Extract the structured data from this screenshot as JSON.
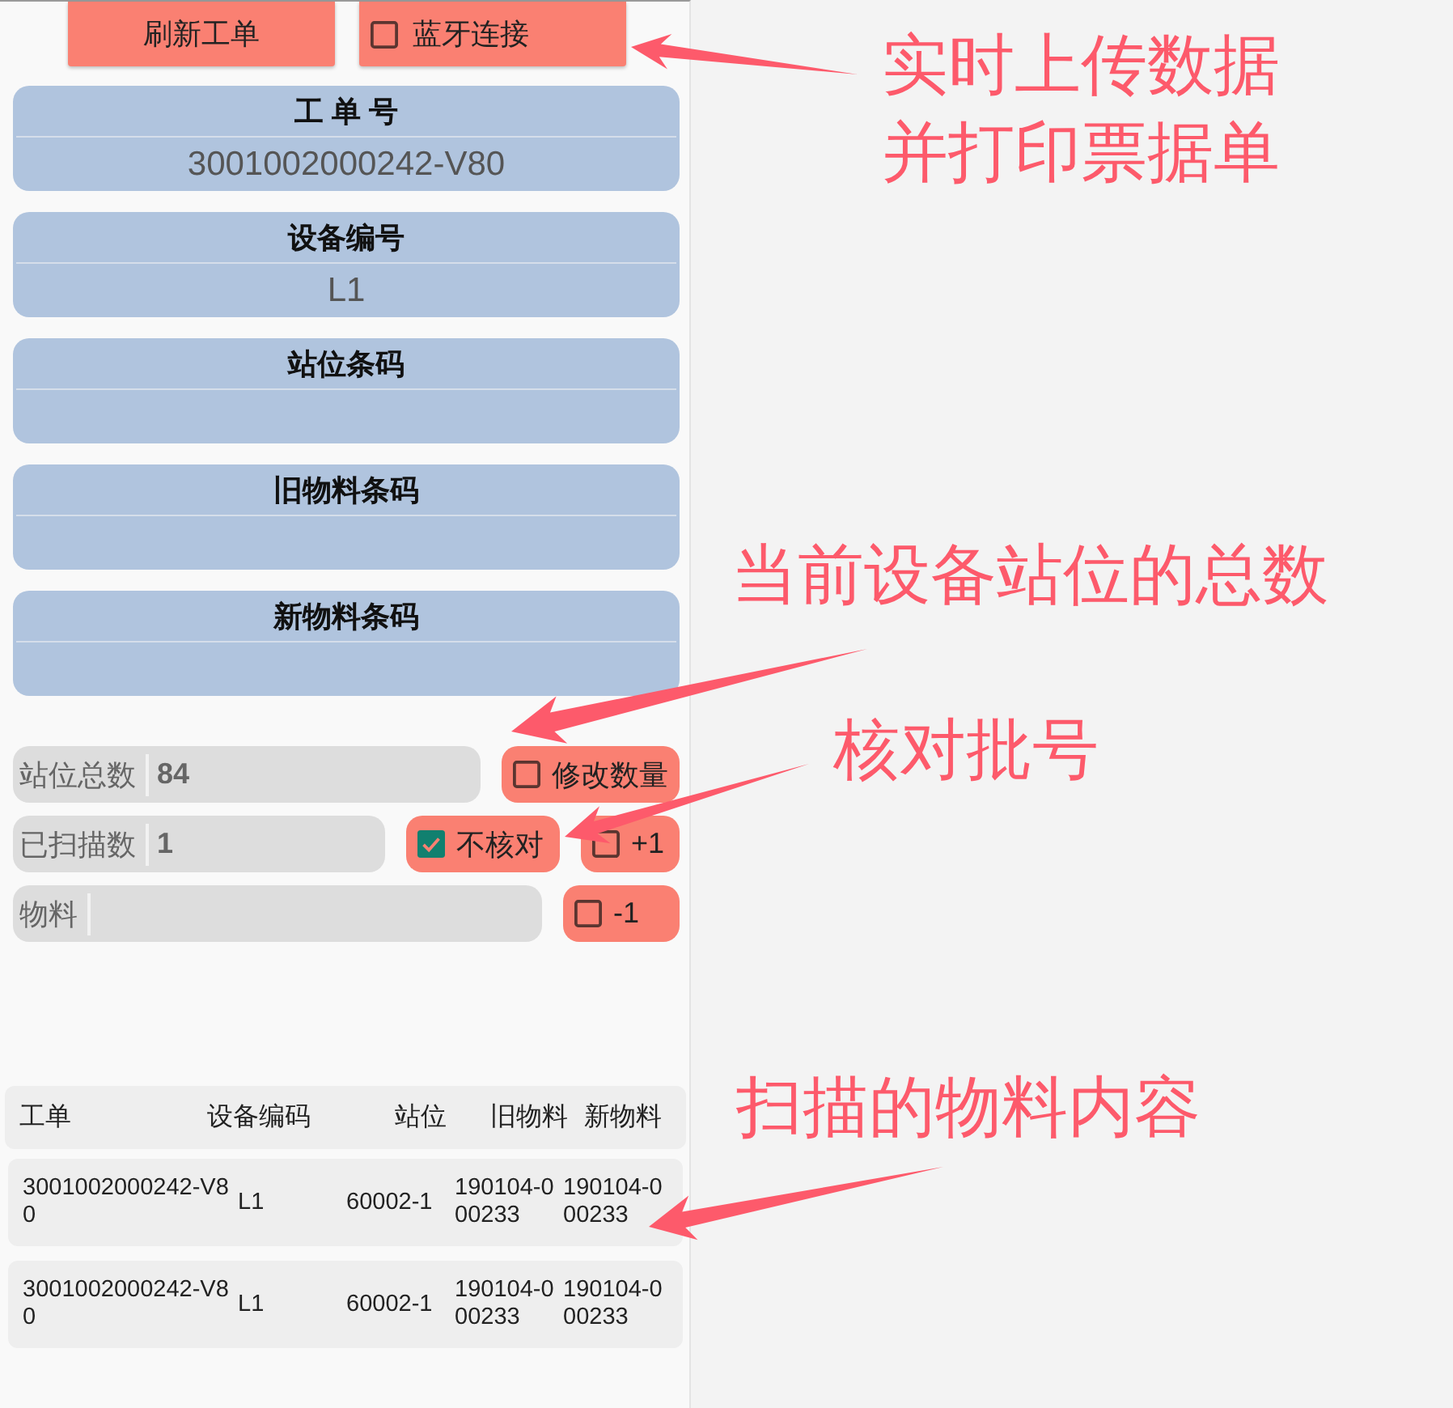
{
  "toolbar": {
    "refresh_button": {
      "label": "刷新工单"
    },
    "bluetooth_checkbox": {
      "label": "蓝牙连接",
      "checked": false
    }
  },
  "scan_cards": [
    {
      "title": "工 单 号",
      "value": "3001002000242-V80"
    },
    {
      "title": "设备编号",
      "value": "L1"
    },
    {
      "title": "站位条码"
    },
    {
      "title": "旧物料条码"
    },
    {
      "title": "新物料条码"
    }
  ],
  "counter_rows": [
    {
      "label": "站位总数",
      "value": "84",
      "toggles": [
        {
          "label": "修改数量",
          "checked": false
        }
      ]
    },
    {
      "label": "已扫描数",
      "value": "1",
      "toggles": [
        {
          "label": "不核对",
          "checked": true
        },
        {
          "label": "+1",
          "checked": false
        }
      ]
    },
    {
      "label": "物料",
      "toggles": [
        {
          "label": "-1",
          "checked": false
        }
      ]
    }
  ],
  "table": {
    "columns": [
      "工单",
      "设备编码",
      "站位",
      "旧物料",
      "新物料"
    ],
    "rows": [
      [
        "3001002000242-V80",
        "L1",
        "60002-1",
        "190104-000233",
        "190104-000233"
      ],
      [
        "3001002000242-V80",
        "L1",
        "60002-1",
        "190104-000233",
        "190104-000233"
      ]
    ]
  },
  "annotations": [
    "实时上传数据并打印票据单",
    "当前设备站位的总数",
    "核对批号",
    "扫描的物料内容"
  ]
}
